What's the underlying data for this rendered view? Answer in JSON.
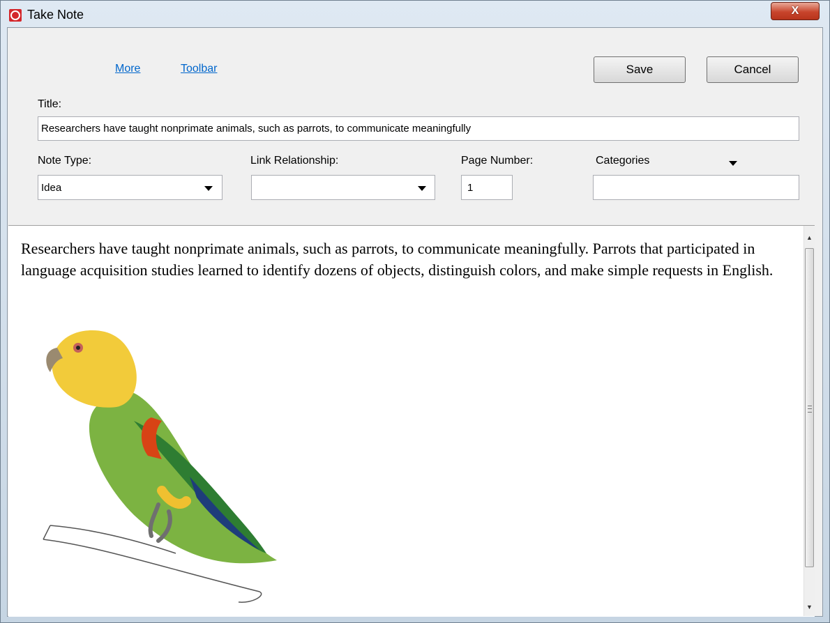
{
  "window": {
    "title": "Take Note",
    "close_label": "X"
  },
  "toolbar": {
    "more_link": "More",
    "toolbar_link": "Toolbar",
    "save_label": "Save",
    "cancel_label": "Cancel"
  },
  "form": {
    "title_label": "Title:",
    "title_value": "Researchers have taught nonprimate animals, such as parrots, to communicate meaningfully",
    "note_type_label": "Note Type:",
    "note_type_value": "Idea",
    "link_relationship_label": "Link Relationship:",
    "link_relationship_value": "",
    "page_number_label": "Page Number:",
    "page_number_value": "1",
    "categories_label": "Categories",
    "categories_value": ""
  },
  "editor": {
    "body_text": "Researchers have taught nonprimate animals, such as parrots, to communicate meaningfully. Parrots that participated in language acquisition studies learned to identify dozens of objects, distinguish colors, and make simple requests in English."
  },
  "icons": [
    "app-icon",
    "close-icon",
    "dropdown-arrow-icon",
    "scroll-up-arrow-icon",
    "scroll-down-arrow-icon",
    "parrot-image"
  ]
}
